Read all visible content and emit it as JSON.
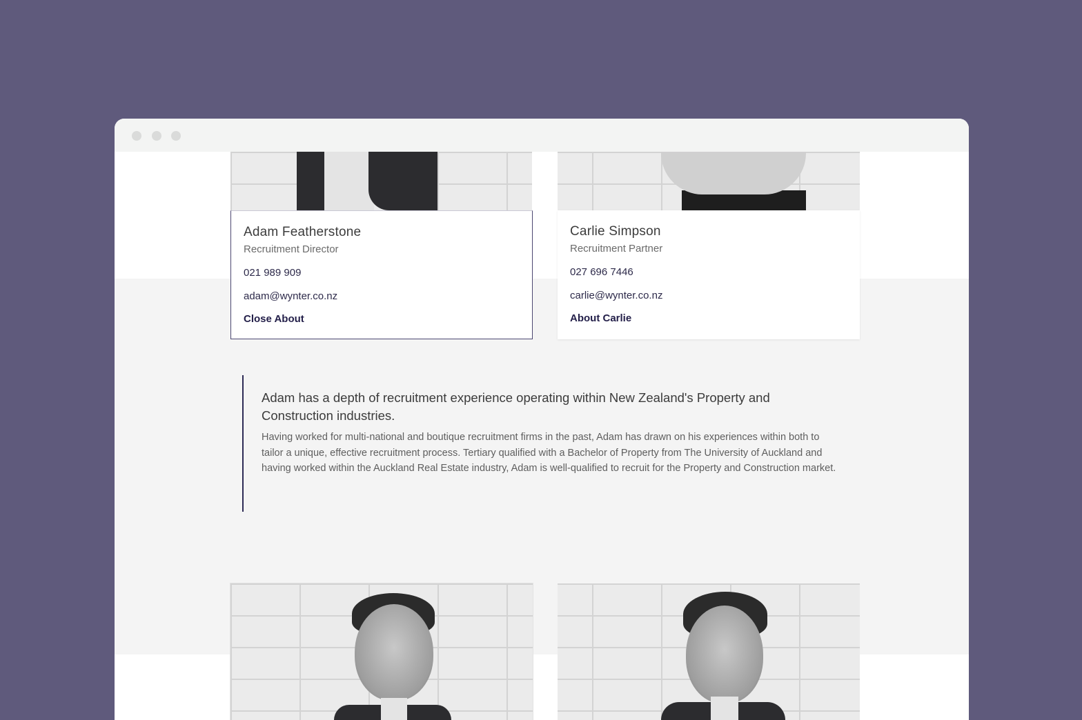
{
  "window": {
    "controls": [
      "close-dot",
      "minimize-dot",
      "maximize-dot"
    ]
  },
  "team": [
    {
      "name": "Adam Featherstone",
      "role": "Recruitment Director",
      "phone": "021 989 909",
      "email": "adam@wynter.co.nz",
      "about_label": "Close About",
      "expanded": true
    },
    {
      "name": "Carlie Simpson",
      "role": "Recruitment Partner",
      "phone": "027 696 7446",
      "email": "carlie@wynter.co.nz",
      "about_label": "About Carlie",
      "expanded": false
    }
  ],
  "bio": {
    "lead": "Adam has a depth of recruitment experience operating within New Zealand's Property and Construction industries.",
    "body": "Having worked for multi-national and boutique recruitment firms in the past, Adam has drawn on his experiences within both to tailor a unique, effective recruitment process. Tertiary qualified with a Bachelor of Property from The University of Auckland and having worked within the Auckland Real Estate industry, Adam is well-qualified to recruit for the Property and Construction market."
  },
  "colors": {
    "page_background": "#5f5a7c",
    "accent": "#2d2a55",
    "link": "#24204a",
    "band": "#f4f4f4"
  },
  "icons": [
    "window-dot-icon",
    "window-dot-icon",
    "window-dot-icon"
  ]
}
